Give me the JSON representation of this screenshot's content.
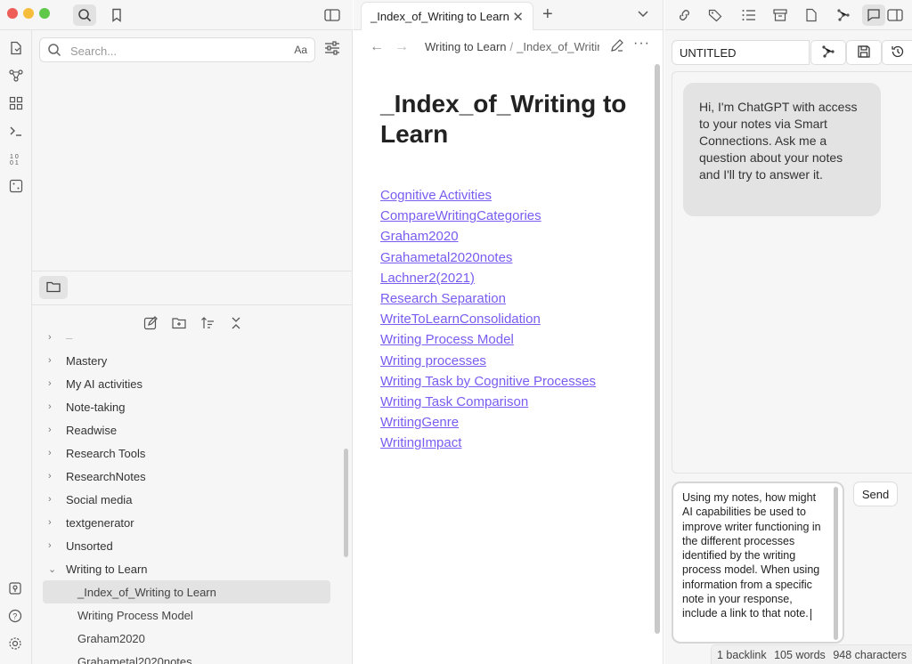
{
  "colors": {
    "link": "#7a5cf0",
    "accent_red": "#ee5e57",
    "accent_yellow": "#f5bd3b",
    "accent_green": "#5fc84a"
  },
  "left_toolbar": {
    "icons": [
      "search-icon",
      "bookmark-icon",
      "sidebar-toggle-icon"
    ]
  },
  "ribbon": {
    "icons": [
      "open-quick-switcher-icon",
      "graph-view-icon",
      "canvas-icon",
      "command-palette-icon",
      "templates-icon",
      "random-note-icon",
      "vault-icon",
      "help-icon",
      "settings-icon"
    ]
  },
  "search": {
    "placeholder": "Search...",
    "match_case": "Aa"
  },
  "file_tree": {
    "folders": [
      "Mastery",
      "My AI activities",
      "Note-taking",
      "Readwise",
      "Research Tools",
      "ResearchNotes",
      "Social media",
      "textgenerator",
      "Unsorted"
    ],
    "open_folder": "Writing to Learn",
    "files": [
      "_Index_of_Writing to Learn",
      "Writing Process Model",
      "Graham2020",
      "Grahametal2020notes"
    ],
    "selected_file": "_Index_of_Writing to Learn"
  },
  "editor": {
    "tab_title": "_Index_of_Writing to Learn",
    "breadcrumb_folder": "Writing to Learn",
    "breadcrumb_sep": "/",
    "breadcrumb_file": "_Index_of_Writing to Learn",
    "heading": "_Index_of_Writing to Learn",
    "links": [
      "Cognitive Activities",
      "CompareWritingCategories",
      "Graham2020",
      "Grahametal2020notes",
      "Lachner2(2021)",
      "Research Separation",
      "WriteToLearnConsolidation",
      "Writing Process Model",
      "Writing processes",
      "Writing Task by Cognitive Processes",
      "Writing Task Comparison",
      "WritingGenre",
      "WritingImpact"
    ]
  },
  "right_panel": {
    "toolbar_icons": [
      "backlinks-icon",
      "tags-icon",
      "outline-icon",
      "archive-icon",
      "file-icon",
      "smart-connections-icon",
      "chat-icon",
      "split-view-icon"
    ],
    "chat_title": "UNTITLED",
    "assistant_message": "Hi, I'm ChatGPT with access to your notes via Smart Connections. Ask me a question about your notes and I'll try to answer it.",
    "user_input": "Using my notes, how might AI capabilities be used to improve writer functioning in the different processes identified by the writing process model. When using information from a specific note in your response, include a link to that note.",
    "send_label": "Send"
  },
  "status": {
    "backlinks": "1 backlink",
    "words": "105 words",
    "characters": "948 characters"
  }
}
